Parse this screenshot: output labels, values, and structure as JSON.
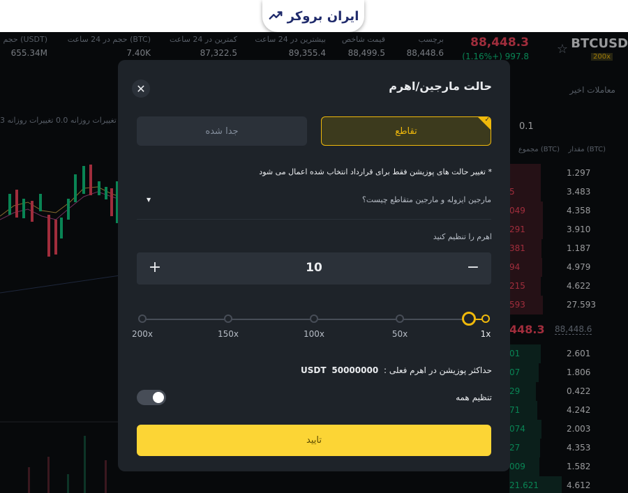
{
  "header": {
    "logo_text": "ایران بروکر",
    "brand_color": "#1f2a6b"
  },
  "stats": {
    "symbol": "BTCUSD",
    "leverage_badge": "200x",
    "last_price": "88,448.3",
    "change": "(1.16%+) 997.8",
    "items": [
      {
        "label": "برچسب",
        "value": "88,448.6"
      },
      {
        "label": "قیمت شاخص",
        "value": "88,499.5"
      },
      {
        "label": "بیشترین در 24 ساعت",
        "value": "89,355.4"
      },
      {
        "label": "کمترین در 24 ساعت",
        "value": "87,322.5"
      },
      {
        "label": "حجم در 24 ساعت (BTC)",
        "value": "7.40K"
      },
      {
        "label": "حجم (USDT)",
        "value": "655.34M"
      }
    ]
  },
  "chart": {
    "legend": "تغییرات روزانه 0.0   تغییرات روزانه 3"
  },
  "orderbook": {
    "tab_recent": "معاملات اخیر",
    "step": "0.1",
    "col_amount": "مقدار (BTC)",
    "col_total": "مجموع (BTC)",
    "asks": [
      {
        "qty": "1.297",
        "left": ""
      },
      {
        "qty": "3.483",
        "left": "5"
      },
      {
        "qty": "4.358",
        "left": "049"
      },
      {
        "qty": "3.910",
        "left": "291"
      },
      {
        "qty": "1.187",
        "left": "381"
      },
      {
        "qty": "4.979",
        "left": "94"
      },
      {
        "qty": "4.622",
        "left": "215"
      },
      {
        "qty": "27.593",
        "left": "593"
      }
    ],
    "mid_price": "448.3",
    "mark_price": "88,448.6",
    "bids": [
      {
        "qty": "2.601",
        "left": "01"
      },
      {
        "qty": "1.806",
        "left": "07"
      },
      {
        "qty": "0.422",
        "left": "29"
      },
      {
        "qty": "4.242",
        "left": "71"
      },
      {
        "qty": "2.003",
        "left": "074"
      },
      {
        "qty": "4.353",
        "left": "27"
      },
      {
        "qty": "1.582",
        "left": "009"
      },
      {
        "qty": "4.612",
        "left": "21.621"
      }
    ]
  },
  "modal": {
    "title": "حالت مارجین/اهرم",
    "close_icon": "close-icon",
    "mode_cross": "تقاطع",
    "mode_isolated": "جدا شده",
    "notice": "* تغییر حالت های پوزیشن فقط برای قرارداد انتخاب شده اعمال می شود",
    "faq": "مارجین ایزوله و مارجین متقاطع چیست؟",
    "leverage_label": "اهرم را تنظیم کنید",
    "leverage_value": "10",
    "slider_marks": [
      "1x",
      "50x",
      "100x",
      "150x",
      "200x"
    ],
    "slider_level_fraction": 0,
    "max_position_label": "حداکثر پوزیشن در اهرم فعلی :",
    "max_position_value": "50000000",
    "max_position_unit": "USDT",
    "apply_all_label": "تنظیم همه",
    "apply_all_on": true,
    "confirm_label": "تایید",
    "accent_color": "#f0b90b",
    "confirm_color": "#fcd535"
  }
}
